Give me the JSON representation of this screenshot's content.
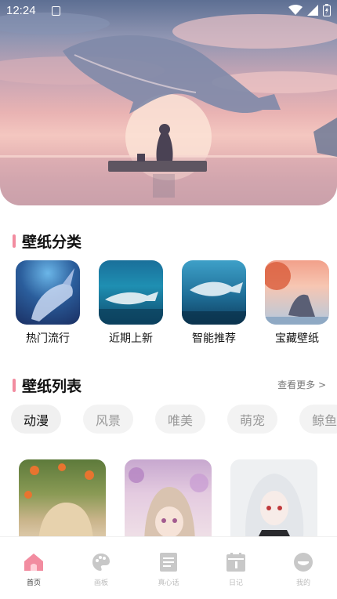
{
  "status_bar": {
    "time": "12:24"
  },
  "sections": {
    "categories_title": "壁纸分类",
    "list_title": "壁纸列表",
    "more_label": "查看更多 >"
  },
  "categories": [
    {
      "label": "热门流行",
      "icon": "whale-thumbnail"
    },
    {
      "label": "近期上新",
      "icon": "whale-thumbnail"
    },
    {
      "label": "智能推荐",
      "icon": "whale-thumbnail"
    },
    {
      "label": "宝藏壁纸",
      "icon": "whale-thumbnail"
    }
  ],
  "chips": [
    "动漫",
    "风景",
    "唯美",
    "萌宠",
    "鲸鱼"
  ],
  "active_chip": "动漫",
  "nav": [
    {
      "label": "首页",
      "icon": "home-icon",
      "active": true
    },
    {
      "label": "画板",
      "icon": "palette-icon",
      "active": false
    },
    {
      "label": "真心话",
      "icon": "document-icon",
      "active": false
    },
    {
      "label": "日记",
      "icon": "calendar-icon",
      "active": false
    },
    {
      "label": "我的",
      "icon": "profile-icon",
      "active": false
    }
  ],
  "colors": {
    "accent": "#f28ca0",
    "nav_active": "#f28ca0",
    "nav_inactive": "#c8c8c8"
  }
}
